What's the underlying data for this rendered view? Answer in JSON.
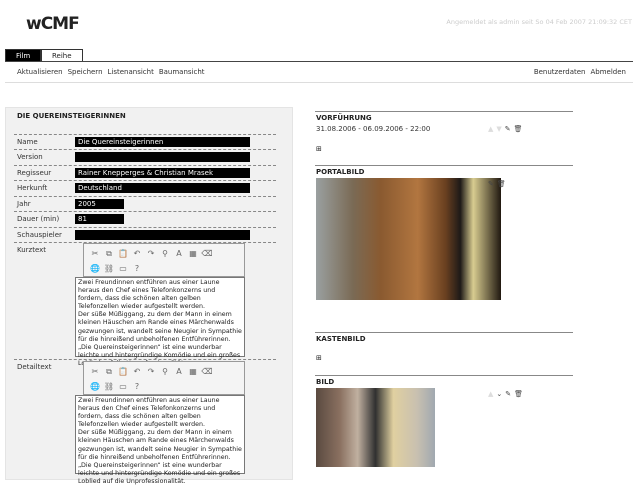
{
  "header": {
    "logo": "wCMF",
    "login_status": "Angemeldet als admin seit So 04 Feb 2007 21:09:32 CET"
  },
  "tabs": [
    {
      "label": "Film"
    },
    {
      "label": "Reihe"
    }
  ],
  "menu_left": [
    "Aktualisieren",
    "Speichern",
    "Listenansicht",
    "Baumansicht"
  ],
  "menu_right": [
    "Benutzerdaten",
    "Abmelden"
  ],
  "form": {
    "title": "DIE QUEREINSTEIGERINNEN",
    "fields": [
      {
        "label": "Name",
        "value": "Die Quereinsteigerinnen"
      },
      {
        "label": "Version",
        "value": ""
      },
      {
        "label": "Regisseur",
        "value": "Rainer Knepperges & Christian Mrasek"
      },
      {
        "label": "Herkunft",
        "value": "Deutschland"
      },
      {
        "label": "Jahr",
        "value": "2005"
      },
      {
        "label": "Dauer (min)",
        "value": "81"
      },
      {
        "label": "Schauspieler",
        "value": ""
      }
    ],
    "kurztext_label": "Kurztext",
    "detailtext_label": "Detailtext",
    "text": "Zwei Freundinnen entführen aus einer Laune heraus den Chef eines Telefonkonzerns und fordern, dass die schönen alten gelben Telefonzellen wieder aufgestellt werden.\nDer süße Müßiggang, zu dem der Mann in einem kleinen Häuschen am Rande eines Märchenwalds gezwungen ist, wandelt seine Neugier in Sympathie für die hinreißend unbeholfenen Entführerinnen. „Die Quereinsteigerinnen“ ist eine wunderbar leichte und hintergründige Komödie und ein großes Loblied auf die Unprofessionalität."
  },
  "right": {
    "vorfuehrung_title": "VORFÜHRUNG",
    "vorfuehrung_date": "31.08.2006 - 06.09.2006 - 22:00",
    "portalbild_title": "PORTALBILD",
    "kastenbild_title": "KASTENBILD",
    "bild_title": "BILD"
  }
}
